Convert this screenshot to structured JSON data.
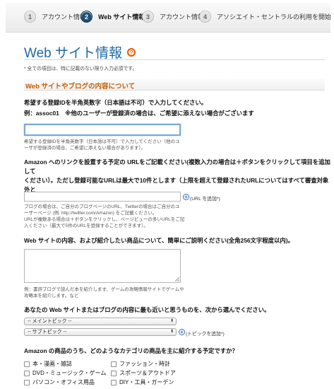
{
  "steps": [
    {
      "num": "1",
      "label": "アカウント情報"
    },
    {
      "num": "2",
      "label": "Web サイト情報"
    },
    {
      "num": "3",
      "label": "アカウント情報"
    },
    {
      "num": "4",
      "label": "アソシエイト・セントラルの利用を開始"
    }
  ],
  "page": {
    "title": "Web サイト情報",
    "help_glyph": "?",
    "required_note": "* 全ての項目は、特に記載のない限り入力必須です。"
  },
  "section": {
    "heading": "Web サイトやブログの内容について"
  },
  "store_id": {
    "question": "希望する登録IDを半角英数字（日本語は不可）で入力してください。",
    "example": "例：assoc01　※他のユーザーが登録済の場合は、ご希望に添えない場合がございます",
    "value": "",
    "help_lines": [
      "希望する登録IDを半角英数字（日本語は不可）で入力してください（他のユ",
      "ーザが登録済の場合、ご希望に添えない場合があります）。"
    ]
  },
  "urls": {
    "question_lines": [
      "Amazon へのリンクを設置する予定の URLをご記載ください(複数入力の場合は＋ボタンをクリックして項目を追加して",
      "ください）。ただし登録可能なURLは最大で10件とします（上限を超えて登録されたURLについてはすべて審査対象外と",
      "なりますのでご注意ください）。"
    ],
    "value": "",
    "add_label": "(URL を追加*)",
    "help_lines": [
      "ブログの場合は、ご自分のブログページのURL、Twitterの場合はご自分のユ",
      "ーザーページ (例: http://twitter.com/Amazon) をご記載ください。",
      "URLが複数ある場合は＋ボタンをクリックし、ページビューの多いURLをご記",
      "入ください（最大で5件のURLを登録することができます）。"
    ]
  },
  "description": {
    "question": "Web サイトの内容、および紹介したい商品について、簡単にご説明ください(全角256文字程度以内)。",
    "value": "",
    "help_lines": [
      "例：書評ブログで読んだ本を紹介します、ゲームの攻略情報サイトでゲームや",
      "攻略本を紹介します。など"
    ]
  },
  "topics": {
    "question": "あなたの Web サイトまたはブログの内容に最も近いと思うものを、次から選んでください。",
    "main_topic": "-- メイントピック --",
    "sub_topic": "-- サブトピック --",
    "add_label": "(トピックを追加*)"
  },
  "categories": {
    "question": "Amazon の商品のうち、どのようなカテゴリの商品を主に紹介する予定ですか？",
    "left": [
      "本・漫画・雑誌",
      "DVD・ミュージック・ゲーム",
      "パソコン・オフィス用品"
    ],
    "right": [
      "ファッション・時計",
      "スポーツ＆アウトドア",
      "DIY・工具・ガーデン"
    ]
  }
}
